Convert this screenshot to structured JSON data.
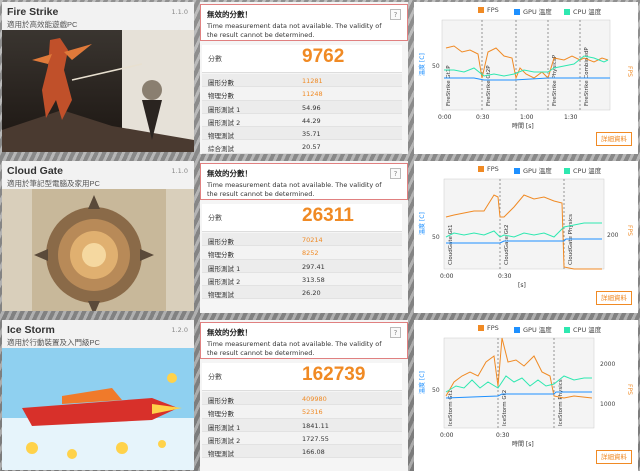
{
  "colors": {
    "fps": "#f08a24",
    "gpu": "#1e90ff",
    "cpu": "#2ee8b0",
    "accent": "#f08a24"
  },
  "legend": {
    "fps": "FPS",
    "gpu": "GPU 溫度",
    "cpu": "CPU 溫度"
  },
  "warning": {
    "title": "無效的分數！",
    "text": "Time measurement data not available. The validity of the result cannot be determined.",
    "help": "?"
  },
  "score_label": "分數",
  "detail_button": "詳細資料",
  "tests": [
    {
      "title": "Fire Strike",
      "subtitle": "適用於高效能遊戲PC",
      "version": "1.1.0",
      "score": "9762",
      "rows": [
        {
          "k": "圖形分數",
          "v": "11281"
        },
        {
          "k": "物理分數",
          "v": "11248"
        },
        {
          "k": "圖形測試 1",
          "v": "54.96"
        },
        {
          "k": "圖形測試 2",
          "v": "44.29"
        },
        {
          "k": "物理測試",
          "v": "35.71"
        },
        {
          "k": "綜合測試",
          "v": "20.57"
        }
      ],
      "chart": {
        "ylabel_left": "溫度 [C]",
        "ylabel_right": "FPS",
        "ytick": "50",
        "segments": [
          "FireStrike Gt1P",
          "FireStrike Gt2P",
          "FireStrike PhysicsP",
          "FireStrike CombinedP"
        ],
        "xticks": [
          "0:00",
          "0:30",
          "1:00",
          "1:30"
        ],
        "xlabel": "時間 [s]"
      }
    },
    {
      "title": "Cloud Gate",
      "subtitle": "適用於筆記型電腦及家用PC",
      "version": "1.1.0",
      "score": "26311",
      "rows": [
        {
          "k": "圖形分數",
          "v": "70214"
        },
        {
          "k": "物理分數",
          "v": "8252"
        },
        {
          "k": "圖形測試 1",
          "v": "297.41"
        },
        {
          "k": "圖形測試 2",
          "v": "313.58"
        },
        {
          "k": "物理測試",
          "v": "26.20"
        }
      ],
      "chart": {
        "ylabel_left": "溫度 [C]",
        "ylabel_right": "FPS",
        "ytick": "50",
        "ytick_right": "200",
        "segments": [
          "CloudGate Gt1",
          "CloudGate Gt2",
          "CloudGate Physics"
        ],
        "xticks": [
          "0:00",
          "0:30"
        ],
        "xlabel": "[s]"
      }
    },
    {
      "title": "Ice Storm",
      "subtitle": "適用於行動裝置及入門級PC",
      "version": "1.2.0",
      "score": "162739",
      "rows": [
        {
          "k": "圖形分數",
          "v": "409980"
        },
        {
          "k": "物理分數",
          "v": "52316"
        },
        {
          "k": "圖形測試 1",
          "v": "1841.11"
        },
        {
          "k": "圖形測試 2",
          "v": "1727.55"
        },
        {
          "k": "物理測試",
          "v": "166.08"
        }
      ],
      "chart": {
        "ylabel_left": "溫度 [C]",
        "ylabel_right": "FPS",
        "ytick": "50",
        "ytick_right": "2000",
        "ytick_right2": "1000",
        "segments": [
          "IceStorm Gt1",
          "IceStorm Gt2",
          "IceStorm Physics"
        ],
        "xticks": [
          "0:00",
          "0:30"
        ],
        "xlabel": "時間 [s]"
      }
    }
  ]
}
